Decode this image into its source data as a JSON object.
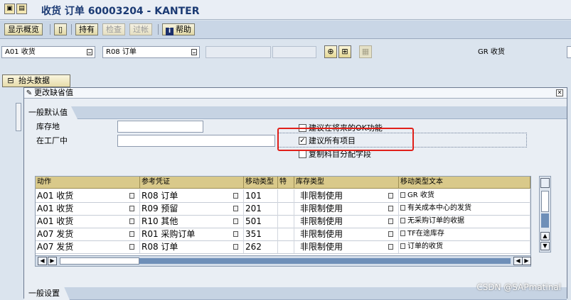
{
  "window": {
    "title": "收货 订单 60003204 - KANTER"
  },
  "toolbar": {
    "buttons": [
      {
        "label": "显示概览",
        "enabled": true
      },
      {
        "label": "持有",
        "enabled": true
      },
      {
        "label": "检查",
        "enabled": false
      },
      {
        "label": "过帐",
        "enabled": false
      },
      {
        "label": "帮助",
        "enabled": true
      }
    ]
  },
  "selection": {
    "action": "A01 收货",
    "reference": "R08 订单",
    "movement_type": "GR 收货"
  },
  "header_button": {
    "label": "抬头数据"
  },
  "dialog": {
    "title": "更改缺省值",
    "group_defaults": {
      "label": "一般默认值",
      "fields": [
        {
          "label": "库存地",
          "value": ""
        },
        {
          "label": "在工厂中",
          "value": ""
        }
      ],
      "checkboxes": [
        {
          "label": "建议在将来的OK功能",
          "checked": false
        },
        {
          "label": "建议所有项目",
          "checked": true
        },
        {
          "label": "复制科目分配字段",
          "checked": false
        }
      ]
    },
    "table": {
      "columns": [
        "动作",
        "参考凭证",
        "移动类型",
        "特",
        "库存类型",
        "移动类型文本"
      ],
      "rows": [
        {
          "action": "A01 收货",
          "ref": "R08 订单",
          "mvt": "101",
          "special": "",
          "stock": "非限制使用",
          "text": "GR 收货"
        },
        {
          "action": "A01 收货",
          "ref": "R09 预留",
          "mvt": "201",
          "special": "",
          "stock": "非限制使用",
          "text": "有关成本中心的发货"
        },
        {
          "action": "A01 收货",
          "ref": "R10 其他",
          "mvt": "501",
          "special": "",
          "stock": "非限制使用",
          "text": "无采购订单的收据"
        },
        {
          "action": "A07 发货",
          "ref": "R01 采购订单",
          "mvt": "351",
          "special": "",
          "stock": "非限制使用",
          "text": "TF在途库存"
        },
        {
          "action": "A07 发货",
          "ref": "R08 订单",
          "mvt": "262",
          "special": "",
          "stock": "非限制使用",
          "text": "订单的收货"
        }
      ]
    },
    "group_settings": {
      "label": "一般设置"
    }
  },
  "watermark": "CSDN @SAPmatinal",
  "colors": {
    "highlight": "#e0201a",
    "table_header": "#d9c98a",
    "title_text": "#1b3a73"
  }
}
